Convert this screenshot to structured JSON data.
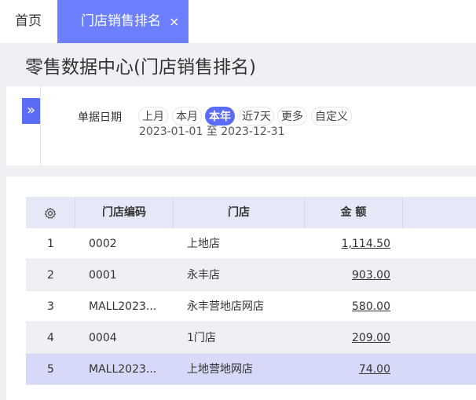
{
  "tabs": {
    "home_label": "首页",
    "active_label": "门店销售排名",
    "close_glyph": "×"
  },
  "page_title": "零售数据中心(门店销售排名)",
  "filter": {
    "expand_glyph": "»",
    "label": "单据日期",
    "chips": [
      "上月",
      "本月",
      "本年",
      "近7天",
      "更多",
      "自定义"
    ],
    "selected_chip": "本年",
    "date_range": "2023-01-01 至 2023-12-31"
  },
  "table": {
    "columns": [
      "门店编码",
      "门店",
      "金 额"
    ],
    "settings_icon": "gear-icon",
    "rows": [
      {
        "index": "1",
        "code": "0002",
        "store": "上地店",
        "amount": "1,114.50"
      },
      {
        "index": "2",
        "code": "0001",
        "store": "永丰店",
        "amount": "903.00"
      },
      {
        "index": "3",
        "code": "MALL2023...",
        "store": "永丰营地店网店",
        "amount": "580.00"
      },
      {
        "index": "4",
        "code": "0004",
        "store": "1门店",
        "amount": "209.00"
      },
      {
        "index": "5",
        "code": "MALL2023...",
        "store": "上地营地网店",
        "amount": "74.00"
      }
    ],
    "selected_row": 5
  },
  "colors": {
    "accent": "#5b6cf6",
    "tab_active": "#6b7fff",
    "header_bg": "#e4e8f7",
    "selected_row_bg": "#d6d9f8"
  }
}
